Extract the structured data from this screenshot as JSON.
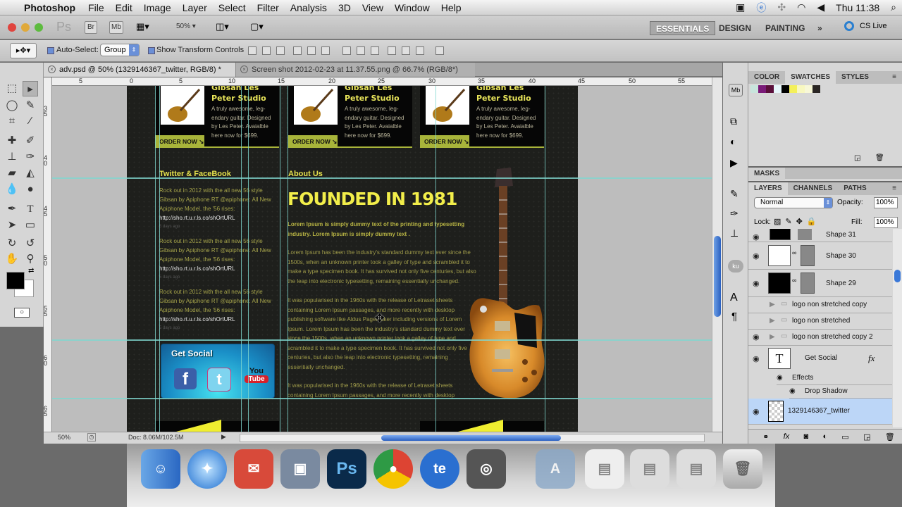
{
  "menubar": {
    "app": "Photoshop",
    "items": [
      "File",
      "Edit",
      "Image",
      "Layer",
      "Select",
      "Filter",
      "Analysis",
      "3D",
      "View",
      "Window",
      "Help"
    ],
    "clock": "Thu 11:38"
  },
  "appbar": {
    "zoom": "50%",
    "workspaces": [
      "ESSENTIALS",
      "DESIGN",
      "PAINTING"
    ],
    "more": "»",
    "cslive": "CS Live",
    "br": "Br",
    "mb": "Mb",
    "ps": "Ps"
  },
  "options": {
    "auto_select_label": "Auto-Select:",
    "auto_select_value": "Group",
    "show_transform_label": "Show Transform Controls"
  },
  "tabs": [
    {
      "label": "adv.psd @ 50% (1329146367_twitter, RGB/8) *"
    },
    {
      "label": "Screen shot 2012-02-23 at 11.37.55.png @ 66.7% (RGB/8*)"
    }
  ],
  "ruler": {
    "top": [
      "5",
      "0",
      "5",
      "10",
      "15",
      "20",
      "25",
      "30",
      "35",
      "40",
      "45",
      "50",
      "55"
    ],
    "left": [
      "35",
      "40",
      "45",
      "50",
      "55",
      "60",
      "65"
    ]
  },
  "canvas": {
    "products": [
      {
        "title_top": "Gibsan Les",
        "title": "Peter Studio",
        "desc": "A truly awesome, leg-endary guitar. Designed by Les Peter. Avaialble here now for $699.",
        "order": "ORDER NOW ↘"
      },
      {
        "title_top": "Gibsan Les",
        "title": "Peter Studio",
        "desc": "A truly awesome, leg-endary guitar. Designed by Les Peter. Avaialble here now for $699.",
        "order": "ORDER NOW ↘"
      },
      {
        "title_top": "Gibsan Les",
        "title": "Peter Studio",
        "desc": "A truly awesome, leg-endary guitar. Designed by Les Peter. Avaialble here now for $699.",
        "order": "ORDER NOW ↘"
      }
    ],
    "twitter_heading": "Twitter & FaceBook",
    "tweets": [
      {
        "text": "Rock out in 2012 with the all new 56 style Gibsan by Apiphone RT @apiphone: All New Apiphone Model, the '56 rises:",
        "url": "http://sho.rt.u.r.ls.co/shOrtURL",
        "ago": "5 days ago"
      },
      {
        "text": "Rock out in 2012 with the all new 56 style Gibsan by Apiphone RT @apiphone: All New Apiphone Model, the '56 rises:",
        "url": "http://sho.rt.u.r.ls.co/shOrtURL",
        "ago": "5 days ago"
      },
      {
        "text": "Rock out in 2012 with the all new 56 style Gibsan by Apiphone RT @apiphone: All New Apiphone Model, the '56 rises:",
        "url": "http://sho.rt.u.r.ls.co/shOrtURL",
        "ago": "5 days ago"
      }
    ],
    "social": {
      "title": "Get Social",
      "facebook": "f",
      "twitter": "t",
      "youtube_top": "You",
      "youtube_bottom": "Tube"
    },
    "about_heading": "About Us",
    "founded": "FOUNDED IN 1981",
    "lead": "Lorem Ipsum is simply dummy text of the printing and typesetting industry. Lorem Ipsum is simply dummy text .",
    "paragraphs": [
      "Lorem Ipsum has been the industry's standard dummy text ever since the 1500s, when an unknown printer took a galley of type and scrambled it to make a type specimen book. It has survived not only five centuries, but also the leap into electronic typesetting, remaining essentially unchanged.",
      "It was popularised in the 1960s with the release of Letraset sheets containing Lorem Ipsum passages, and more recently with desktop publishing software like Aldus PageMaker including versions of Lorem Ipsum. Lorem Ipsum has been the industry's standard dummy text ever since the 1500s, when an unknown printer took a galley of type and scrambled it to make a type specimen book. It has survived not only five centuries, but also the leap into electronic typesetting, remaining essentially unchanged.",
      "It was popularised in the 1960s with the release of Letraset sheets containing Lorem Ipsum passages, and more recently with desktop"
    ]
  },
  "status": {
    "zoom": "50%",
    "doc": "Doc: 8.06M/102.5M"
  },
  "panels": {
    "color_tabs": [
      "COLOR",
      "SWATCHES",
      "STYLES"
    ],
    "swatches": [
      "#c8e4dc",
      "#7a1a78",
      "#5a0f3a",
      "#e6f6fa",
      "#000000",
      "#f4f05a",
      "#f8f8c0",
      "#f8f8d8",
      "#2a2624"
    ],
    "masks": "MASKS",
    "layer_tabs": [
      "LAYERS",
      "CHANNELS",
      "PATHS"
    ],
    "blend_mode": "Normal",
    "opacity_label": "Opacity:",
    "opacity": "100%",
    "lock_label": "Lock:",
    "fill_label": "Fill:",
    "fill": "100%",
    "layers": [
      {
        "name": "Shape 31",
        "visible": true
      },
      {
        "name": "Shape 30",
        "visible": true
      },
      {
        "name": "Shape 29",
        "visible": true
      },
      {
        "name": "logo non stretched copy",
        "visible": false
      },
      {
        "name": "logo non stretched",
        "visible": false
      },
      {
        "name": "logo non stretched copy 2",
        "visible": true
      },
      {
        "name": "Get Social",
        "visible": true,
        "fx": "fx"
      },
      {
        "name": "Effects"
      },
      {
        "name": "Drop Shadow"
      },
      {
        "name": "1329146367_twitter",
        "visible": true,
        "selected": true
      }
    ]
  },
  "dock": [
    "Finder",
    "Safari",
    "Mail",
    "iPhoto",
    "Ps",
    "Chrome",
    "te",
    "Photo Booth",
    "Applications",
    "Downloads",
    "Trash"
  ],
  "colors": {
    "accent_green": "#a8b43a",
    "heading_yellow": "#e6e24e",
    "guide": "#7fd7d0",
    "selection": "#bcd6f7"
  }
}
